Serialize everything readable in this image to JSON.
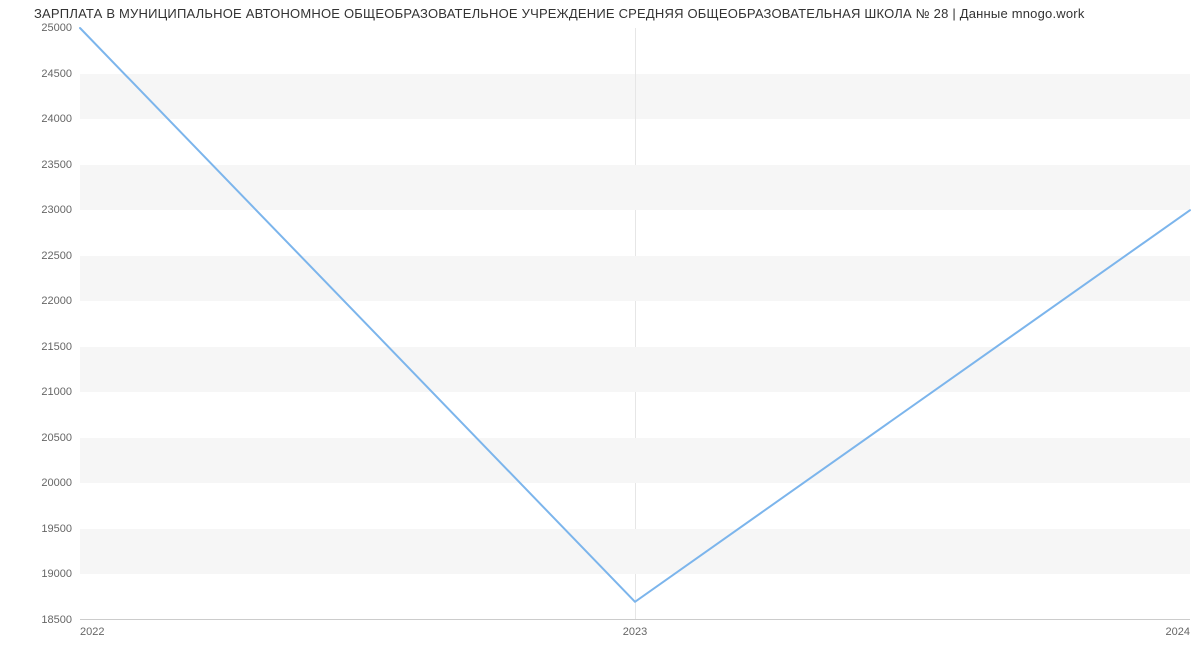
{
  "chart_data": {
    "type": "line",
    "title": "ЗАРПЛАТА В МУНИЦИПАЛЬНОЕ АВТОНОМНОЕ ОБЩЕОБРАЗОВАТЕЛЬНОЕ УЧРЕЖДЕНИЕ СРЕДНЯЯ ОБЩЕОБРАЗОВАТЕЛЬНАЯ ШКОЛА № 28 | Данные mnogo.work",
    "xlabel": "",
    "ylabel": "",
    "x": [
      "2022",
      "2023",
      "2024"
    ],
    "values": [
      25000,
      18700,
      23000
    ],
    "ylim": [
      18500,
      25000
    ],
    "y_ticks": [
      18500,
      19000,
      19500,
      20000,
      20500,
      21000,
      21500,
      22000,
      22500,
      23000,
      23500,
      24000,
      24500,
      25000
    ],
    "line_color": "#7cb5ec",
    "stripe_color": "#f6f6f6"
  }
}
